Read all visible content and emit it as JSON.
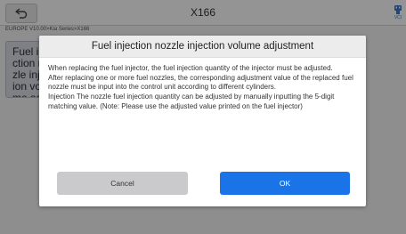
{
  "app": {
    "title": "X166",
    "breadcrumb": "EUROPE V10.00>Kia Series>X166",
    "corner_icon": "vci-status-icon",
    "corner_label": "VCI",
    "back_icon": "back-arrow-icon",
    "left_tile_text": "Fuel injection nozzle injection volume adjustment"
  },
  "dialog": {
    "title": "Fuel injection nozzle injection volume adjustment",
    "paragraphs": [
      "When replacing the fuel injector, the fuel injection quantity of the injector must be adjusted.",
      "After replacing one or more fuel nozzles, the corresponding adjustment value of the replaced fuel nozzle must be input into the control unit according to different cylinders.",
      "Injection The nozzle fuel injection quantity can be adjusted by manually inputting the 5-digit matching value. (Note: Please use the adjusted value printed on the fuel injector)"
    ],
    "cancel_label": "Cancel",
    "ok_label": "OK"
  },
  "colors": {
    "accent": "#1a74e8",
    "cancel_button": "#cacacc",
    "dialog_header": "#ececec"
  }
}
